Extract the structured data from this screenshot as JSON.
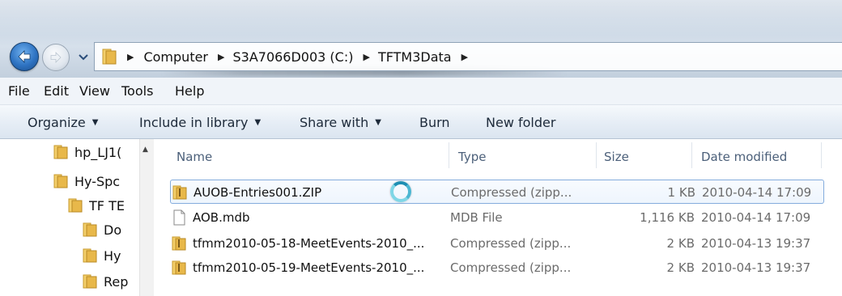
{
  "address": {
    "crumbs": [
      "Computer",
      "S3A7066D003 (C:)",
      "TFTM3Data"
    ]
  },
  "menu": {
    "file": "File",
    "edit": "Edit",
    "view": "View",
    "tools": "Tools",
    "help": "Help"
  },
  "toolbar": {
    "organize": "Organize",
    "include_in_library": "Include in library",
    "share_with": "Share with",
    "burn": "Burn",
    "new_folder": "New folder"
  },
  "nav_tree": [
    {
      "label": "hp_LJ1("
    },
    {
      "label": "Hy-Spc"
    },
    {
      "label": "TF TE"
    },
    {
      "label": "Do"
    },
    {
      "label": "Hy"
    },
    {
      "label": "Rep"
    }
  ],
  "columns": {
    "name": "Name",
    "type": "Type",
    "size": "Size",
    "date": "Date modified"
  },
  "files": [
    {
      "name": "AUOB-Entries001.ZIP",
      "type": "Compressed (zipp...",
      "size": "1 KB",
      "date": "2010-04-14 17:09",
      "icon": "zip-folder-icon",
      "selected": true
    },
    {
      "name": "AOB.mdb",
      "type": "MDB File",
      "size": "1,116 KB",
      "date": "2010-04-14 17:09",
      "icon": "file-icon",
      "selected": false
    },
    {
      "name": "tfmm2010-05-18-MeetEvents-2010_...",
      "type": "Compressed (zipp...",
      "size": "2 KB",
      "date": "2010-04-13 19:37",
      "icon": "zip-folder-icon",
      "selected": false
    },
    {
      "name": "tfmm2010-05-19-MeetEvents-2010_...",
      "type": "Compressed (zipp...",
      "size": "2 KB",
      "date": "2010-04-13 19:37",
      "icon": "zip-folder-icon",
      "selected": false
    }
  ],
  "colors": {
    "folder": "#e8b84a",
    "selection_border": "#84acdd",
    "address_bar_glass": "#c9d6e4"
  }
}
